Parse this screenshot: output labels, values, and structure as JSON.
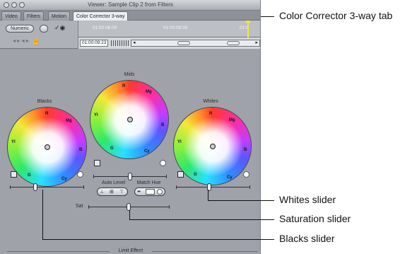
{
  "window": {
    "title": "Viewer: Sample Clip 2 from Filters",
    "tabs": [
      {
        "label": "Video"
      },
      {
        "label": "Filters"
      },
      {
        "label": "Motion"
      },
      {
        "label": "Color Corrector 3-way"
      }
    ],
    "active_tab": "Color Corrector 3-way"
  },
  "controls": {
    "numeric_label": "Numeric",
    "timecode": "01:00:09:23",
    "ruler_ticks": [
      "01:00:06:00",
      "01:00:08:00",
      "01:0"
    ]
  },
  "wheels": [
    {
      "title": "Blacks",
      "labels": {
        "R": "R",
        "Mg": "Mg",
        "B": "B",
        "Cy": "Cy",
        "G": "G",
        "Yl": "Yl"
      },
      "slider_level": 0.35
    },
    {
      "title": "Mids",
      "labels": {
        "R": "R",
        "Mg": "Mg",
        "B": "B",
        "Cy": "Cy",
        "G": "G",
        "Yl": "Yl"
      },
      "slider_level": 0.5
    },
    {
      "title": "Whites",
      "labels": {
        "R": "R",
        "Mg": "Mg",
        "B": "B",
        "Cy": "Cy",
        "G": "G",
        "Yl": "Yl"
      },
      "slider_level": 0.45
    }
  ],
  "auto_level_label": "Auto Level",
  "match_hue_label": "Match Hue",
  "sat_label": "Sat",
  "sat_level": 0.5,
  "limit_effect_label": "Limit Effect",
  "callouts": {
    "tab": "Color Corrector 3-way tab",
    "whites": "Whites slider",
    "saturation": "Saturation slider",
    "blacks": "Blacks slider"
  },
  "colors": {
    "accent": "#f2e83a"
  }
}
